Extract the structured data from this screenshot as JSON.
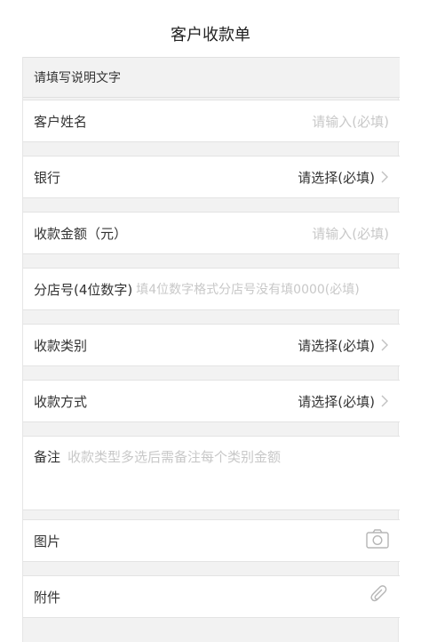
{
  "page": {
    "title": "客户收款单"
  },
  "form": {
    "hint": "请填写说明文字",
    "customer_name": {
      "label": "客户姓名",
      "placeholder": "请输入(必填)"
    },
    "bank": {
      "label": "银行",
      "value": "请选择(必填)"
    },
    "amount": {
      "label": "收款金额（元）",
      "placeholder": "请输入(必填)"
    },
    "branch_no": {
      "label": "分店号(4位数字)",
      "placeholder": "填4位数字格式分店号没有填0000(必填)"
    },
    "category": {
      "label": "收款类别",
      "value": "请选择(必填)"
    },
    "method": {
      "label": "收款方式",
      "value": "请选择(必填)"
    },
    "remark": {
      "label": "备注",
      "placeholder": "收款类型多选后需备注每个类别金额"
    },
    "image": {
      "label": "图片",
      "icon": "camera-icon"
    },
    "attachment": {
      "label": "附件",
      "icon": "paperclip-icon"
    }
  },
  "colors": {
    "placeholder": "#c8c8c8",
    "text": "#333333",
    "background": "#f2f2f2"
  }
}
